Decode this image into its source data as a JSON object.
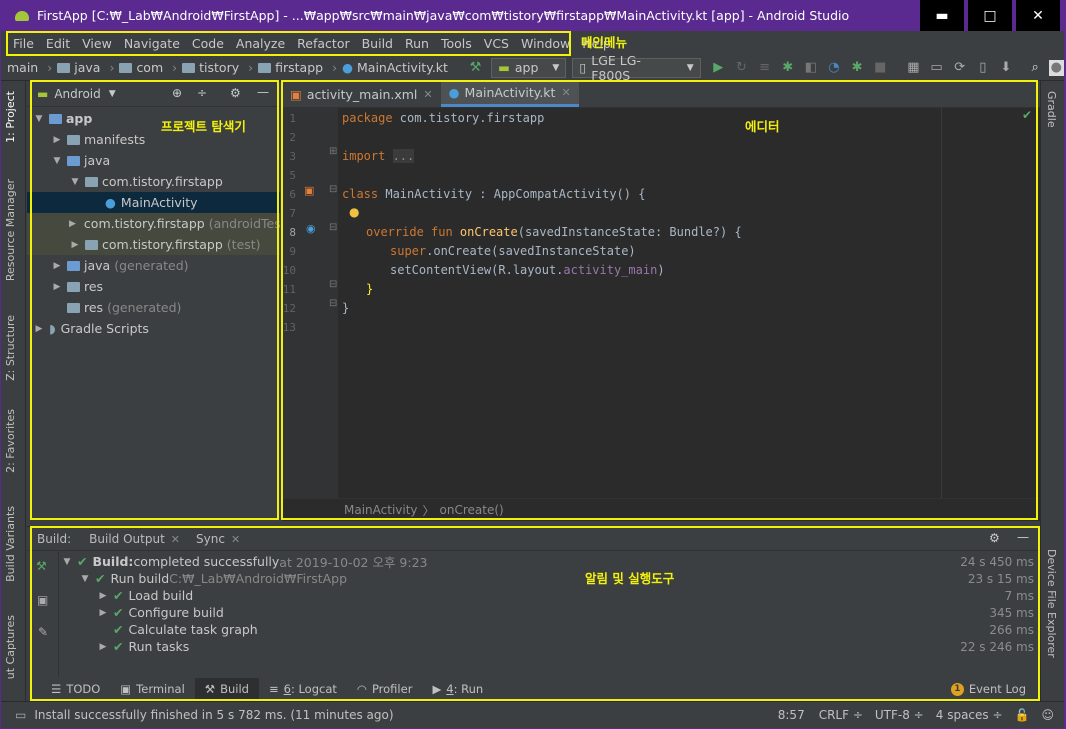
{
  "window": {
    "title": "FirstApp [C:₩_Lab₩Android₩FirstApp] - ...₩app₩src₩main₩java₩com₩tistory₩firstapp₩MainActivity.kt [app] - Android Studio",
    "minimize": "▬",
    "maximize": "□",
    "close": "✕"
  },
  "menu": [
    "File",
    "Edit",
    "View",
    "Navigate",
    "Code",
    "Analyze",
    "Refactor",
    "Build",
    "Run",
    "Tools",
    "VCS",
    "Window",
    "Help"
  ],
  "nav": {
    "crumbs": [
      "main",
      "java",
      "com",
      "tistory",
      "firstapp",
      "MainActivity.kt"
    ],
    "config": "app",
    "device": "LGE LG-F800S"
  },
  "left_strip": [
    "1: Project",
    "Resource Manager",
    "Z: Structure",
    "2: Favorites",
    "Build Variants",
    "ut Captures"
  ],
  "right_strip": [
    "Gradle",
    "Device File Explorer"
  ],
  "project": {
    "view": "Android",
    "tree": [
      {
        "label": "app",
        "dim": ""
      },
      {
        "label": "manifests",
        "dim": ""
      },
      {
        "label": "java",
        "dim": ""
      },
      {
        "label": "com.tistory.firstapp",
        "dim": ""
      },
      {
        "label": "MainActivity",
        "dim": ""
      },
      {
        "label": "com.tistory.firstapp",
        "dim": "(androidTest)"
      },
      {
        "label": "com.tistory.firstapp",
        "dim": "(test)"
      },
      {
        "label": "java",
        "dim": "(generated)"
      },
      {
        "label": "res",
        "dim": ""
      },
      {
        "label": "res",
        "dim": "(generated)"
      },
      {
        "label": "Gradle Scripts",
        "dim": ""
      }
    ]
  },
  "editor": {
    "tabs": [
      {
        "label": "activity_main.xml"
      },
      {
        "label": "MainActivity.kt"
      }
    ],
    "line_numbers": [
      "1",
      "2",
      "3",
      "5",
      "6",
      "7",
      "8",
      "9",
      "10",
      "11",
      "12",
      "13"
    ],
    "code": {
      "l1a": "package ",
      "l1b": "com.tistory.firstapp",
      "l3a": "import ",
      "l3b": "...",
      "l6a": "class ",
      "l6b": "MainActivity : AppCompatActivity() {",
      "l8a": "override fun ",
      "l8b": "onCreate",
      "l8c": "(savedInstanceState: Bundle?) {",
      "l9a": "super",
      ".l9b": "",
      "l9x": ".onCreate(savedInstanceState)",
      "l10a": "setContentView(R.layout.",
      "l10b": "activity_main",
      "l10c": ")",
      "l11": "}",
      "l12": "}"
    },
    "breadcrumb": [
      "MainActivity",
      "onCreate()"
    ]
  },
  "build": {
    "label": "Build:",
    "tabs": [
      "Build Output",
      "Sync"
    ],
    "rows": [
      {
        "text": "Build:",
        "rest": " completed successfully",
        "dim": " at 2019-10-02 오후 9:23",
        "time": "24 s 450 ms"
      },
      {
        "text": "Run build",
        "rest": "",
        "dim": " C:₩_Lab₩Android₩FirstApp",
        "time": "23 s 15 ms"
      },
      {
        "text": "Load build",
        "rest": "",
        "dim": "",
        "time": "7 ms"
      },
      {
        "text": "Configure build",
        "rest": "",
        "dim": "",
        "time": "345 ms"
      },
      {
        "text": "Calculate task graph",
        "rest": "",
        "dim": "",
        "time": "266 ms"
      },
      {
        "text": "Run tasks",
        "rest": "",
        "dim": "",
        "time": "22 s 246 ms"
      }
    ]
  },
  "bottom_tabs": {
    "todo": "TODO",
    "terminal": "Terminal",
    "build": "Build",
    "logcat_num": "6",
    "logcat": ": Logcat",
    "profiler": "Profiler",
    "run_num": "4",
    "run": ": Run",
    "eventlog": "Event Log",
    "event_count": "1"
  },
  "status": {
    "message": "Install successfully finished in 5 s 782 ms. (11 minutes ago)",
    "pos": "8:57",
    "crlf": "CRLF ÷",
    "enc": "UTF-8 ÷",
    "indent": "4 spaces ÷"
  },
  "annotations": {
    "menu": "메인메뉴",
    "project": "프로젝트 탐색기",
    "editor": "에디터",
    "build": "알림 및 실행도구"
  },
  "colors": {
    "accent": "#4a88c7",
    "highlight": "#f1f10a",
    "titlebar": "#5a2a91",
    "success": "#59a869"
  }
}
